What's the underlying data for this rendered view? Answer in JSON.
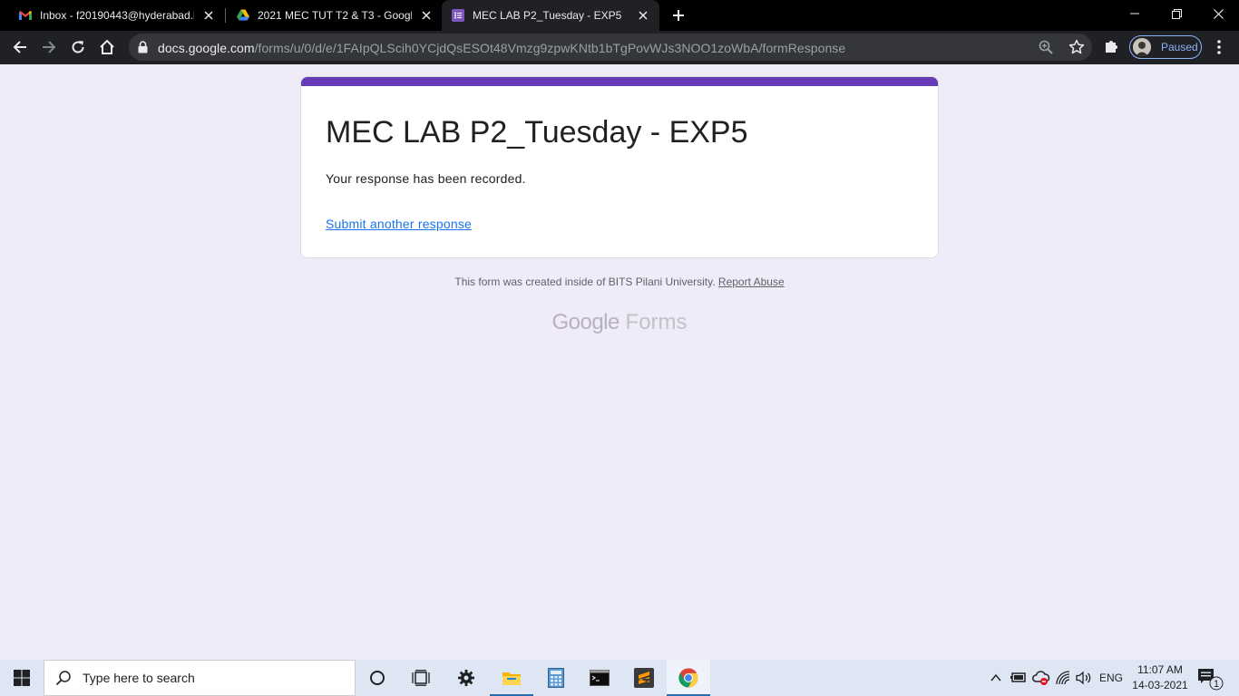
{
  "browser": {
    "tabs": [
      {
        "title": "Inbox - f20190443@hyderabad.b",
        "icon": "gmail-icon"
      },
      {
        "title": "2021 MEC TUT T2 & T3 - Google",
        "icon": "google-drive-icon"
      },
      {
        "title": "MEC LAB P2_Tuesday - EXP5",
        "icon": "google-forms-icon"
      }
    ],
    "url_host": "docs.google.com",
    "url_path": "/forms/u/0/d/e/1FAIpQLScih0YCjdQsESOt48Vmzg9zpwKNtb1bTgPovWJs3NOO1zoWbA/formResponse",
    "profile_status": "Paused"
  },
  "form": {
    "title": "MEC LAB P2_Tuesday - EXP5",
    "confirmation": "Your response has been recorded.",
    "submit_another": "Submit another response",
    "footer_text": "This form was created inside of BITS Pilani University.",
    "report_abuse": "Report Abuse",
    "brand_google": "Google",
    "brand_forms": "Forms",
    "accent_color": "#673ab7",
    "page_background": "#f0ebf8"
  },
  "taskbar": {
    "search_placeholder": "Type here to search",
    "language": "ENG",
    "time": "11:07 AM",
    "date": "14-03-2021",
    "notification_count": "1"
  }
}
